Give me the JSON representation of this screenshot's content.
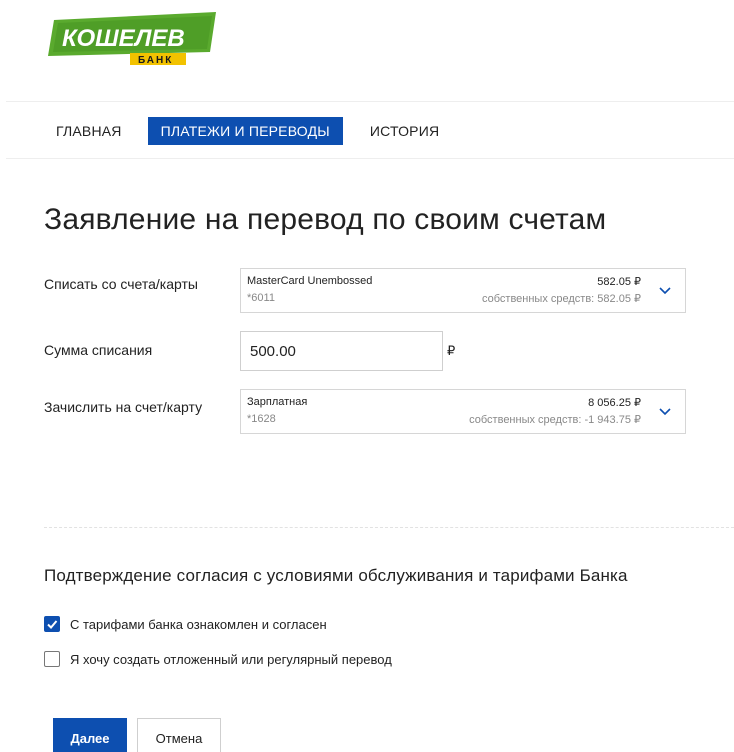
{
  "logo": {
    "name": "КОШЕЛЕВ",
    "sub": "БАНК"
  },
  "colors": {
    "accent": "#0d4fb0",
    "logo_green": "#5aaa2e",
    "logo_yellow": "#f2c200"
  },
  "nav": {
    "items": [
      "ГЛАВНАЯ",
      "ПЛАТЕЖИ И ПЕРЕВОДЫ",
      "ИСТОРИЯ"
    ],
    "active": "ПЛАТЕЖИ И ПЕРЕВОДЫ"
  },
  "page": {
    "title": "Заявление на перевод по своим счетам"
  },
  "form": {
    "from": {
      "label": "Списать со счета/карты",
      "name": "MasterCard Unembossed",
      "number": "*6011",
      "balance": "582.05 ₽",
      "own_funds": "собственных средств: 582.05 ₽"
    },
    "amount": {
      "label": "Сумма списания",
      "value": "500.00",
      "currency": "₽"
    },
    "to": {
      "label": "Зачислить на счет/карту",
      "name": "Зарплатная",
      "number": "*1628",
      "balance": "8 056.25 ₽",
      "own_funds": "собственных средств: -1 943.75 ₽"
    }
  },
  "consent": {
    "title": "Подтверждение согласия с условиями обслуживания и тарифами Банка",
    "items": [
      {
        "label": "С тарифами банка ознакомлен и согласен",
        "checked": true
      },
      {
        "label": "Я хочу создать отложенный или регулярный перевод",
        "checked": false
      }
    ]
  },
  "buttons": {
    "next": "Далее",
    "cancel": "Отмена"
  }
}
